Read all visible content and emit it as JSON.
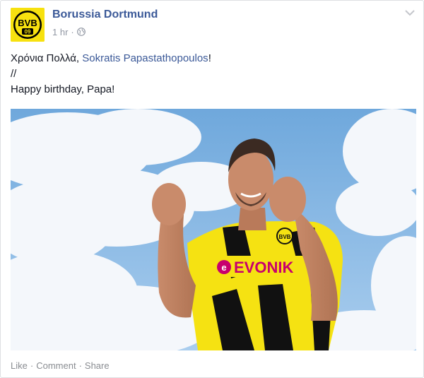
{
  "post": {
    "page_name": "Borussia Dortmund",
    "timestamp": "1 hr",
    "separator": "·",
    "privacy_icon": "globe-icon",
    "menu_icon": "chevron-down-icon",
    "message": {
      "line1_prefix": "Χρόνια Πολλά, ",
      "line1_mention": "Sokratis Papastathopoulos",
      "line1_suffix": "!",
      "line2": "//",
      "line3": "Happy birthday, Papa!"
    },
    "avatar": {
      "logo_text": "BVB",
      "logo_number": "09",
      "colors": {
        "yellow": "#f7e10f",
        "black": "#000000"
      }
    },
    "photo": {
      "sponsor_text": "EVONIK",
      "crest_text": "BVB",
      "colors": {
        "sky": "#8dbde8",
        "jersey": "#f5e212",
        "stripe": "#111111",
        "sponsor": "#c8006e"
      }
    }
  },
  "actions": {
    "like": "Like",
    "comment": "Comment",
    "share": "Share",
    "separator": "·"
  },
  "colors": {
    "link": "#3b5998",
    "meta": "#9197a3",
    "text": "#141823"
  }
}
